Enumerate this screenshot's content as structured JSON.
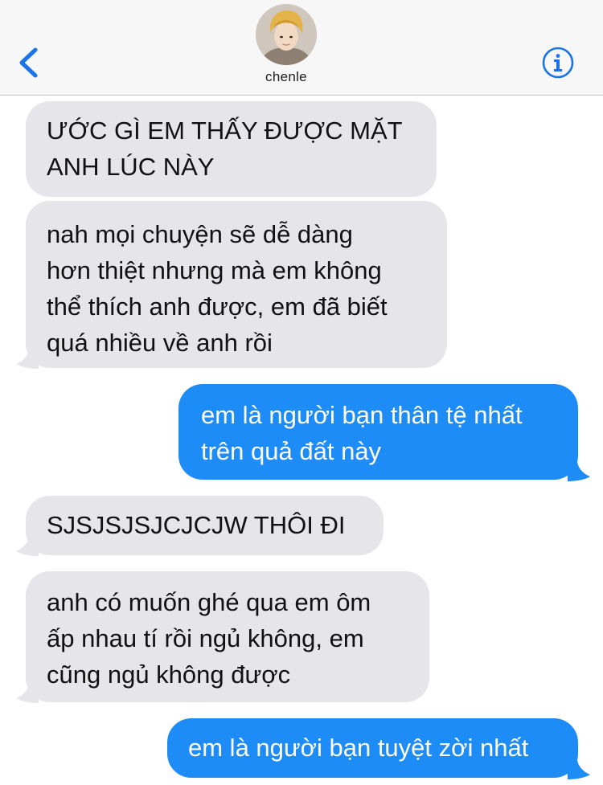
{
  "header": {
    "back_icon": "chevron-left-icon",
    "info_icon": "info-circle-icon",
    "contact_name": "chenle",
    "accent_color": "#1a73e8"
  },
  "messages": [
    {
      "direction": "received",
      "text": "ƯỚC GÌ EM THẤY ĐƯỢC MẶT\nANH LÚC NÀY"
    },
    {
      "direction": "received",
      "text": "nah mọi chuyện sẽ dễ dàng\nhơn thiệt nhưng mà em không\nthể thích anh được, em đã biết\nquá nhiều về anh rồi"
    },
    {
      "direction": "sent",
      "text": "em là người bạn thân tệ nhất\ntrên quả đất này"
    },
    {
      "direction": "received",
      "text": "SJSJSJSJCJCJW THÔI ĐI"
    },
    {
      "direction": "received",
      "text": "anh có muốn ghé qua em ôm\nấp nhau tí rồi ngủ không, em\ncũng ngủ không được"
    },
    {
      "direction": "sent",
      "text": "em là người bạn tuyệt zời nhất"
    }
  ],
  "colors": {
    "received_bubble": "#e5e5ea",
    "sent_bubble": "#1e8cf7",
    "header_bg": "#f7f7f8"
  }
}
